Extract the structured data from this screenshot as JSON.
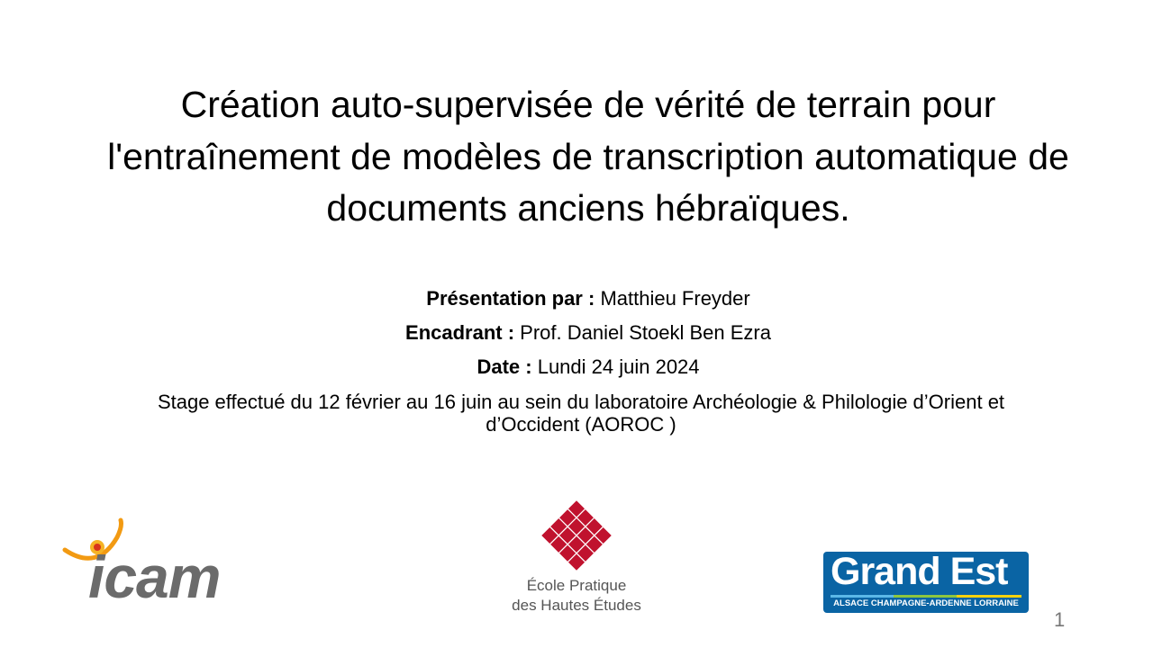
{
  "title": "Création auto-supervisée de vérité de terrain pour l'entraînement de modèles de transcription automatique de documents anciens hébraïques.",
  "presenter": {
    "label": "Présentation par :",
    "value": "Matthieu Freyder"
  },
  "supervisor": {
    "label": "Encadrant :",
    "value": "Prof. Daniel Stoekl Ben Ezra"
  },
  "date": {
    "label": "Date :",
    "value": "Lundi 24 juin 2024"
  },
  "internship": "Stage effectué du 12 février au 16 juin au sein du laboratoire Archéologie & Philologie d’Orient et d’Occident (AOROC )",
  "logos": {
    "icam": "icam",
    "ephe_line1": "École Pratique",
    "ephe_line2": "des Hautes Études",
    "grandest_main": "Grand Est",
    "grandest_sub": "ALSACE CHAMPAGNE-ARDENNE LORRAINE"
  },
  "page_number": "1",
  "colors": {
    "ephe_red": "#c0122e",
    "grandest_blue": "#0a64a4",
    "icam_orange": "#f29a12",
    "icam_gray": "#6b6b6b"
  }
}
